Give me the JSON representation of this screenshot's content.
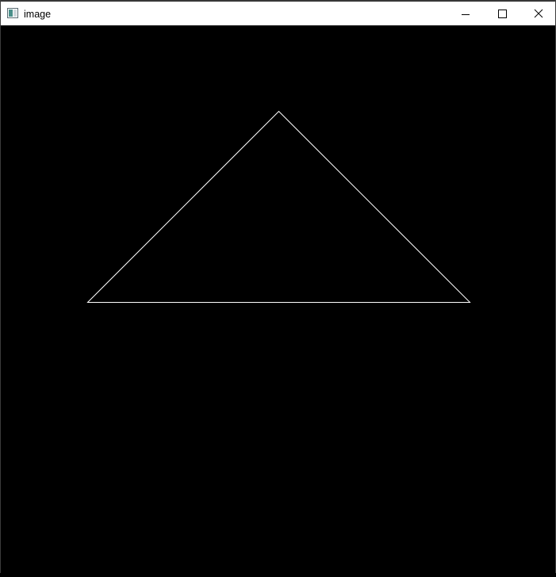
{
  "window": {
    "title": "image",
    "icon": "image-window-icon",
    "controls": {
      "minimize_icon": "minimize-icon",
      "maximize_icon": "maximize-icon",
      "close_icon": "close-icon"
    }
  },
  "canvas": {
    "background_color": "#000000",
    "shape": {
      "type": "triangle-outline",
      "stroke_color": "#ffffff"
    }
  }
}
